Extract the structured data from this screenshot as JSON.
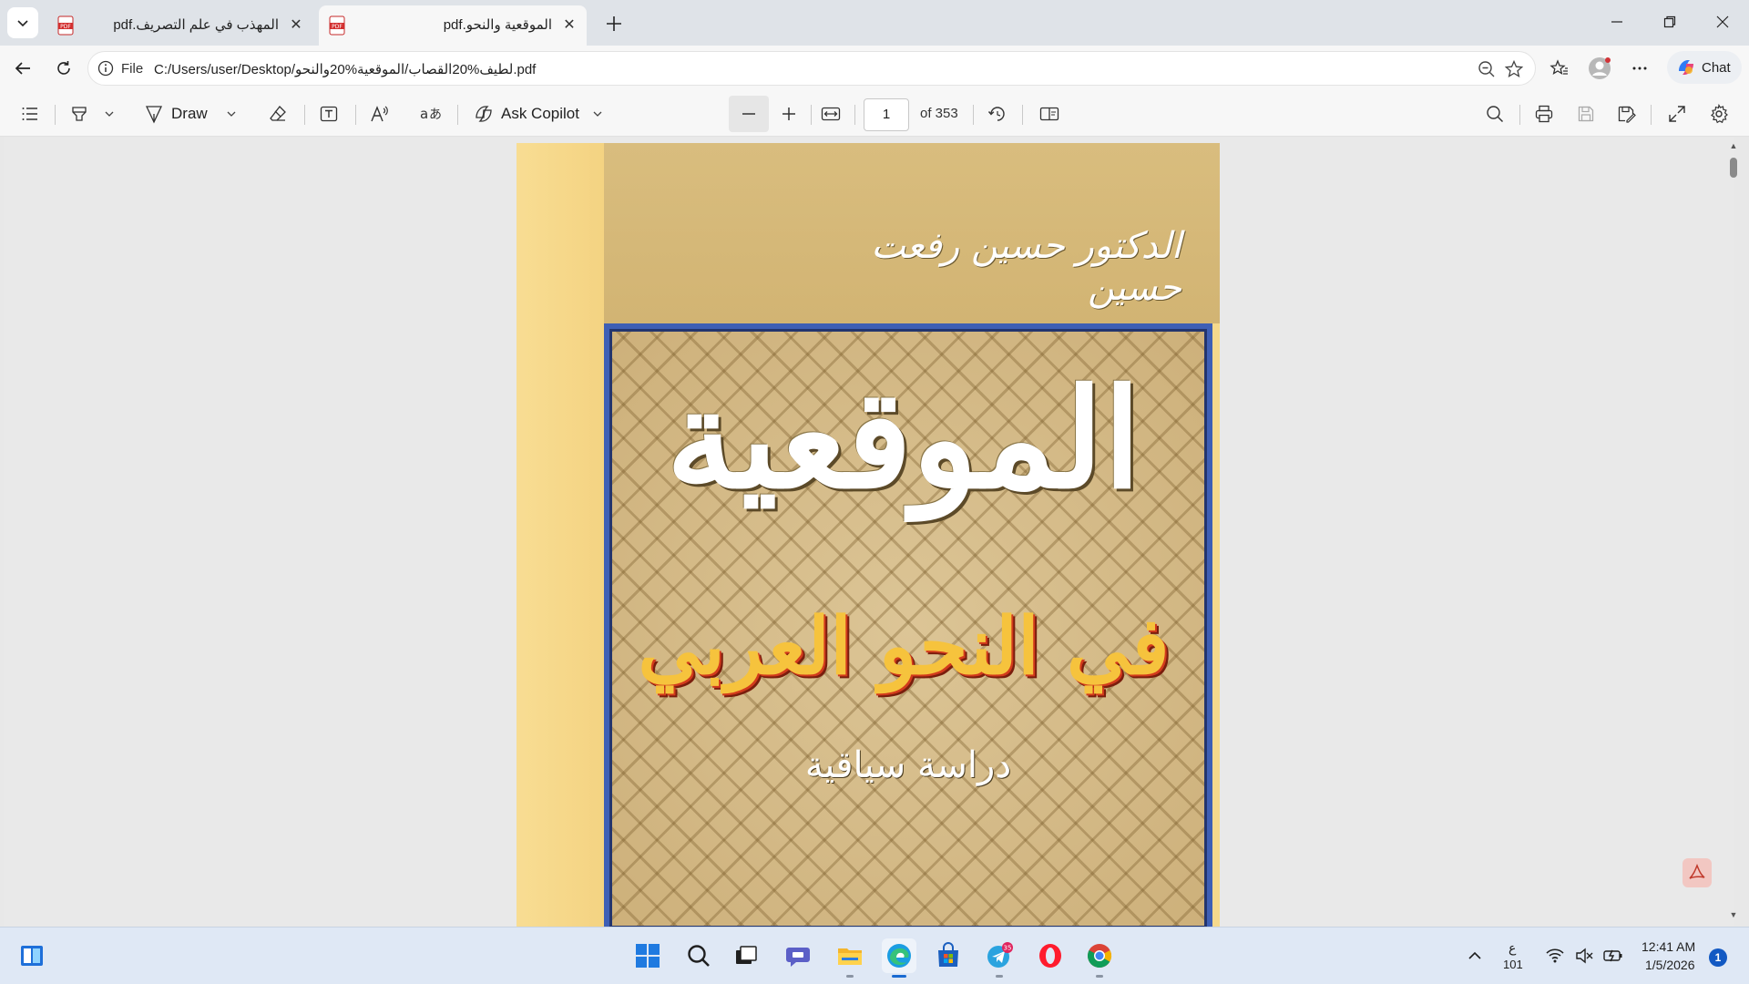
{
  "tabs": [
    {
      "title": "المهذب في علم التصريف.pdf",
      "icon": "pdf-icon",
      "active": false
    },
    {
      "title": "الموقعية والنحو.pdf",
      "icon": "pdf-icon",
      "active": true
    }
  ],
  "address": {
    "scheme": "File",
    "url": "C:/Users/user/Desktop/لطيف%20القصاب/الموقعية%20والنحو.pdf"
  },
  "copilot": {
    "label": "Chat"
  },
  "pdf_toolbar": {
    "draw_label": "Draw",
    "ask_copilot_label": "Ask Copilot",
    "page_current": "1",
    "page_total": "of 353"
  },
  "document": {
    "author": "الدكتور حسين رفعت حسين",
    "title_line1": "الموقعية",
    "title_line2": "في النحو العربي",
    "subtitle": "دراسة سياقية"
  },
  "taskbar": {
    "telegram_badge": "35",
    "keyboard_lang": "ع",
    "keyboard_code": "101",
    "time": "12:41 AM",
    "date": "1/5/2026",
    "notifications": "1"
  },
  "colors": {
    "accent": "#1a6ad1",
    "frame_blue": "#3e5fb5"
  }
}
